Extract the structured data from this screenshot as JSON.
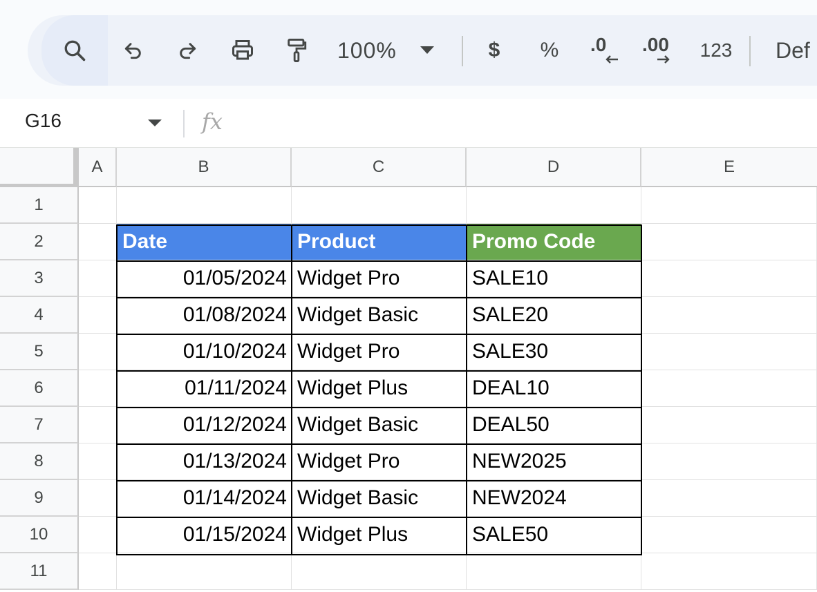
{
  "toolbar": {
    "zoom": "100%",
    "currency_label": "$",
    "percent_label": "%",
    "decrease_decimal_label": ".0",
    "increase_decimal_label": ".00",
    "more_formats_label": "123",
    "font_label": "Def"
  },
  "formula_bar": {
    "name_box": "G16",
    "fx_label": "fx",
    "formula": ""
  },
  "columns": [
    "A",
    "B",
    "C",
    "D",
    "E"
  ],
  "rows": [
    "1",
    "2",
    "3",
    "4",
    "5",
    "6",
    "7",
    "8",
    "9",
    "10",
    "11"
  ],
  "table": {
    "headers": [
      "Date",
      "Product",
      "Promo Code"
    ],
    "header_colors": [
      "#4a86e8",
      "#4a86e8",
      "#6aa84f"
    ],
    "rows": [
      [
        "01/05/2024",
        "Widget Pro",
        "SALE10"
      ],
      [
        "01/08/2024",
        "Widget Basic",
        "SALE20"
      ],
      [
        "01/10/2024",
        "Widget Pro",
        "SALE30"
      ],
      [
        "01/11/2024",
        "Widget Plus",
        "DEAL10"
      ],
      [
        "01/12/2024",
        "Widget Basic",
        "DEAL50"
      ],
      [
        "01/13/2024",
        "Widget Pro",
        "NEW2025"
      ],
      [
        "01/14/2024",
        "Widget Basic",
        "NEW2024"
      ],
      [
        "01/15/2024",
        "Widget Plus",
        "SALE50"
      ]
    ]
  },
  "icons": [
    "search-icon",
    "undo-icon",
    "redo-icon",
    "print-icon",
    "paint-format-icon",
    "zoom-dropdown-icon",
    "namebox-dropdown-icon"
  ]
}
